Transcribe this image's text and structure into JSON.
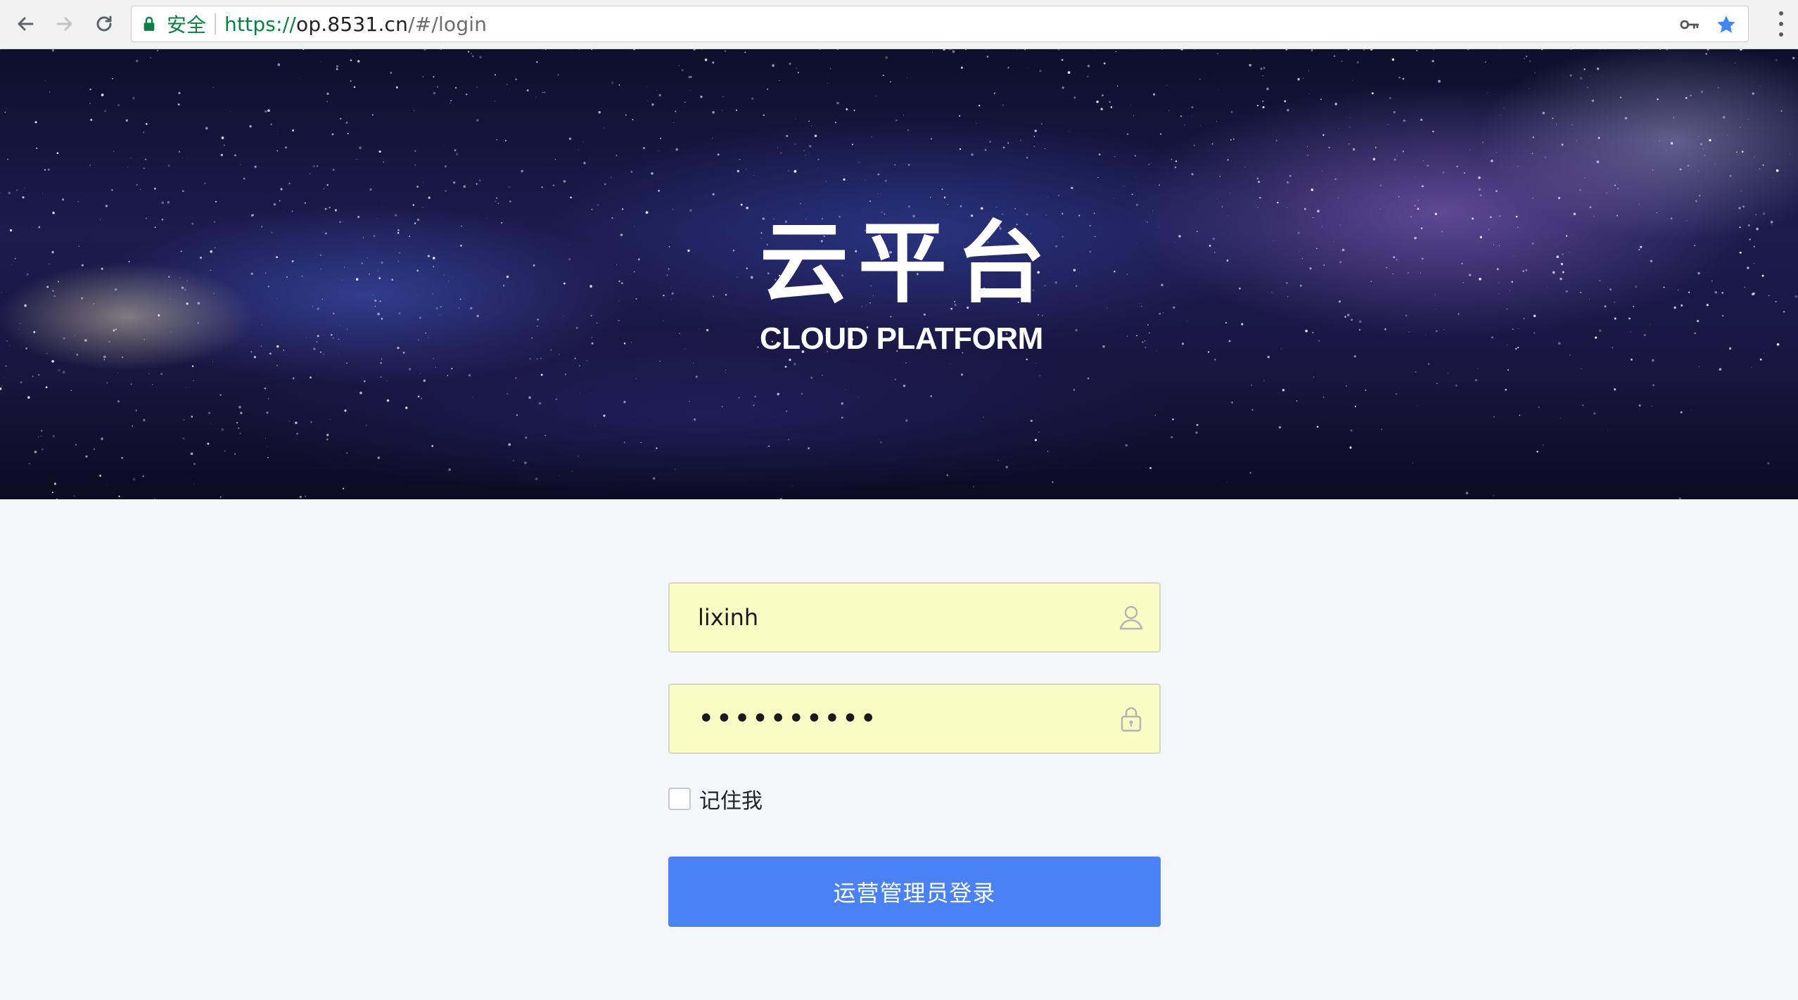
{
  "browser": {
    "secure_label": "安全",
    "url_scheme": "https://",
    "url_host": "op.8531.cn",
    "url_path": "/#/login",
    "accent_secure": "#0b8043",
    "bookmark_color": "#4285f4"
  },
  "banner": {
    "logo_cn": "云平台",
    "logo_en": "CLOUD PLATFORM"
  },
  "login": {
    "username_value": "lixinh",
    "password_value": "••••••••••",
    "remember_label": "记住我",
    "remember_checked": false,
    "submit_label": "运营管理员登录",
    "field_bg": "#fafcc5",
    "button_color": "#4a82f5"
  },
  "icons": {
    "back": "arrow-left-icon",
    "forward": "arrow-right-icon",
    "reload": "reload-icon",
    "lock": "lock-icon",
    "key": "key-icon",
    "star": "star-icon",
    "menu": "kebab-menu-icon",
    "user": "user-icon",
    "password": "padlock-icon"
  }
}
